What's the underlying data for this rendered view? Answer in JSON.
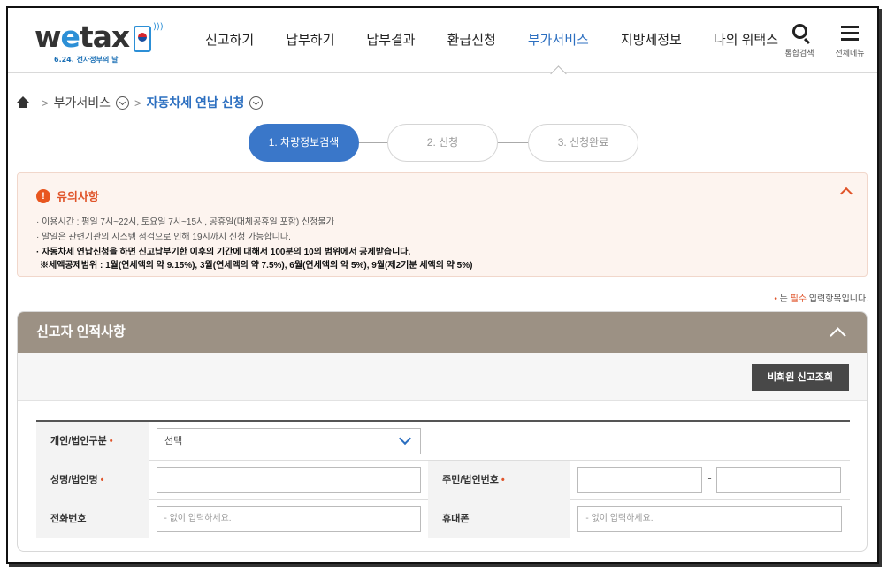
{
  "header": {
    "logo_text_a": "w",
    "logo_text_e": "e",
    "logo_text_b": "tax",
    "logo_sub": "6.24. 전자정부의 날",
    "nav": [
      "신고하기",
      "납부하기",
      "납부결과",
      "환급신청",
      "부가서비스",
      "지방세정보",
      "나의 위택스"
    ],
    "active_nav": "부가서비스",
    "search_label": "통합검색",
    "menu_label": "전체메뉴"
  },
  "breadcrumb": {
    "level1": "부가서비스",
    "current": "자동차세 연납 신청"
  },
  "steps": [
    "1. 차량정보검색",
    "2. 신청",
    "3. 신청완료"
  ],
  "notice": {
    "title": "유의사항",
    "lines": [
      "· 이용시간 : 평일 7시~22시, 토요일 7시~15시, 공휴일(대체공휴일 포함) 신청불가",
      "· 말일은 관련기관의 시스템 점검으로 인해 19시까지 신청 가능합니다.",
      "· 자동차세 연납신청을 하면 신고납부기한 이후의 기간에 대해서 100분의 10의 범위에서 공제받습니다.",
      "※세액공제범위 : 1월(연세액의 약 9.15%), 3월(연세액의 약 7.5%), 6월(연세액의 약 5%), 9월(제2기분 세액의 약 5%)"
    ]
  },
  "required_note": {
    "star": "•",
    "before": " 는 ",
    "emph": "필수",
    "after": " 입력항목입니다."
  },
  "section": {
    "title": "신고자 인적사항",
    "nonmember_button": "비회원 신고조회"
  },
  "form": {
    "type_label": "개인/법인구분",
    "type_value": "선택",
    "name_label": "성명/법인명",
    "id_label": "주민/법인번호",
    "dash": "-",
    "phone_label": "전화번호",
    "phone_placeholder": "- 없이 입력하세요.",
    "mobile_label": "휴대폰",
    "mobile_placeholder": "- 없이 입력하세요.",
    "star": "•"
  },
  "colors": {
    "accent": "#3a77c9",
    "section_head": "#9c9184",
    "notice_bg": "#fdf4ef",
    "alert": "#e0542a"
  }
}
